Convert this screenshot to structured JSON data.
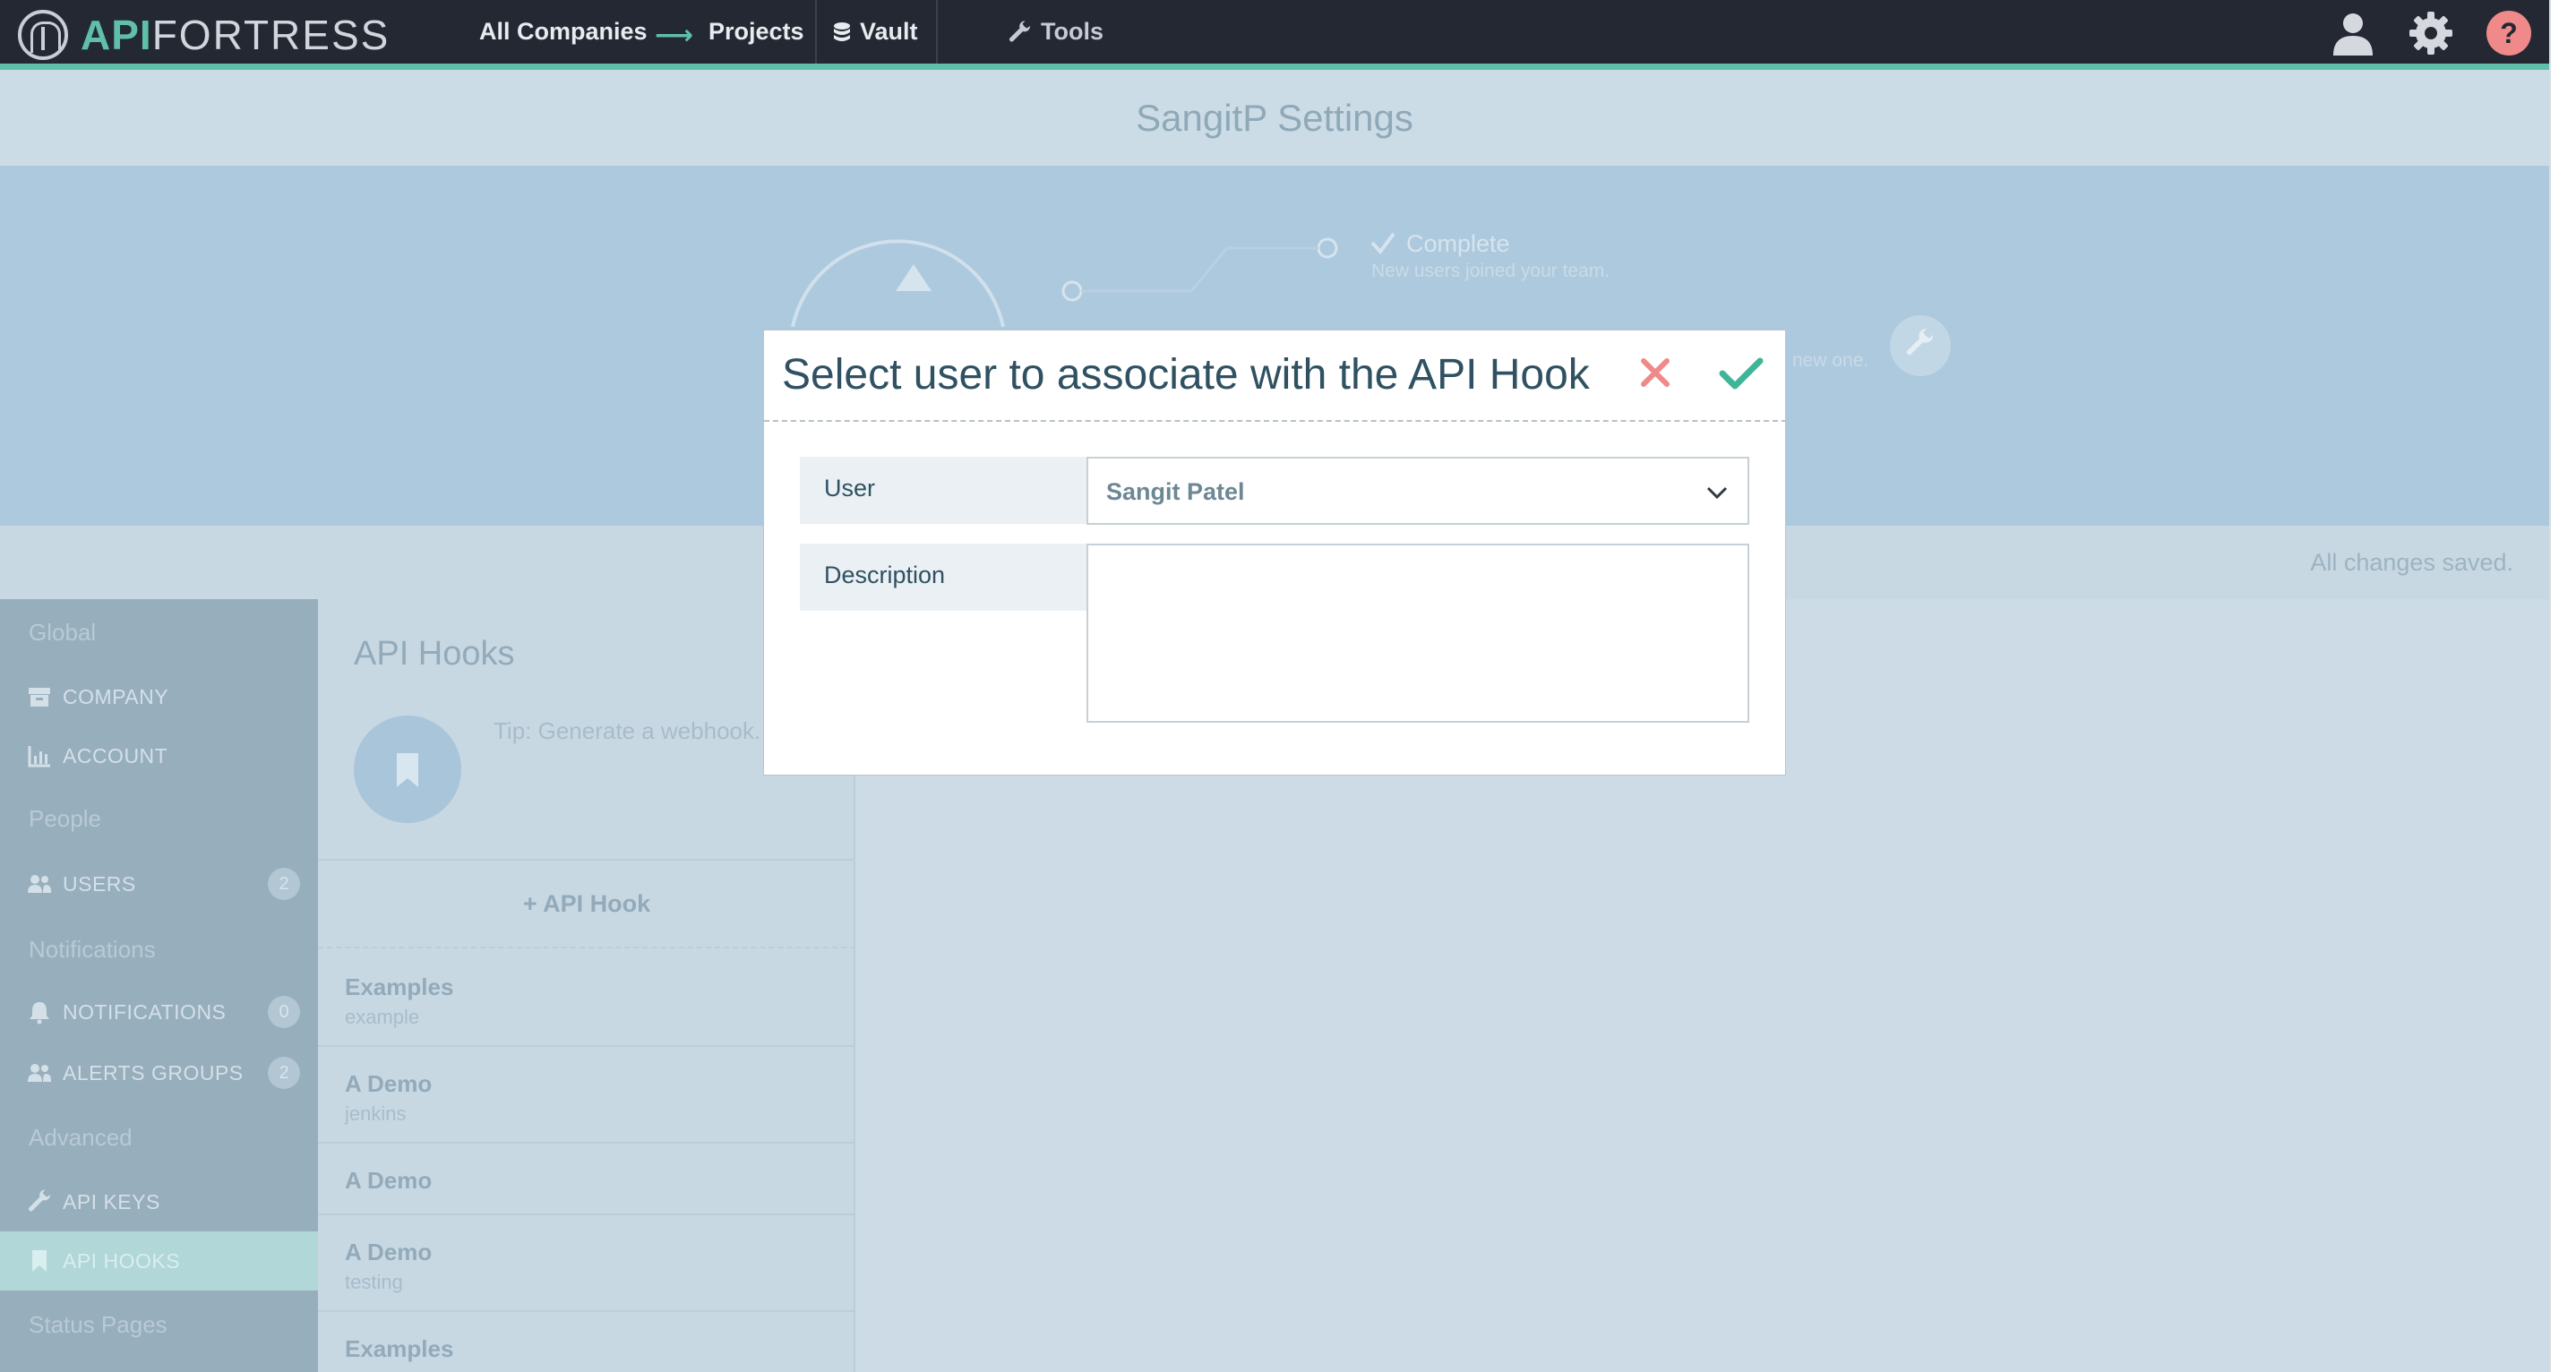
{
  "topbar": {
    "logo_api": "API",
    "logo_fortress": "FORTRESS",
    "nav": {
      "all_companies": "All Companies",
      "projects": "Projects",
      "vault": "Vault",
      "tools": "Tools"
    },
    "icons": [
      "user-icon",
      "gear-icon",
      "help-icon"
    ]
  },
  "page": {
    "title": "SangitP Settings",
    "status": "All changes saved."
  },
  "hero": {
    "step_complete_title": "Complete",
    "step_complete_desc": "New users joined your team.",
    "partial_text": "new one."
  },
  "sidebar": {
    "sections": {
      "global": "Global",
      "people": "People",
      "notifications": "Notifications",
      "advanced": "Advanced",
      "status_pages": "Status Pages"
    },
    "items": {
      "company": "COMPANY",
      "account": "ACCOUNT",
      "users": "USERS",
      "users_count": "2",
      "notifications": "NOTIFICATIONS",
      "notifications_count": "0",
      "alerts_groups": "ALERTS GROUPS",
      "alerts_groups_count": "2",
      "api_keys": "API KEYS",
      "api_hooks": "API HOOKS"
    }
  },
  "hooks": {
    "title": "API Hooks",
    "tip": "Tip: Generate a webhook.",
    "add_label": "+ API Hook",
    "list": [
      {
        "name": "Examples",
        "sub": "example"
      },
      {
        "name": "A Demo",
        "sub": "jenkins"
      },
      {
        "name": "A Demo",
        "sub": ""
      },
      {
        "name": "A Demo",
        "sub": "testing"
      },
      {
        "name": "Examples",
        "sub": ""
      }
    ]
  },
  "modal": {
    "title": "Select user to associate with the API Hook",
    "user_label": "User",
    "user_value": "Sangit Patel",
    "description_label": "Description",
    "description_value": ""
  },
  "colors": {
    "accent": "#5fbfa9",
    "topbar": "#232833",
    "close": "#f08a8a",
    "confirm": "#3fb597",
    "help": "#f08a8a"
  }
}
